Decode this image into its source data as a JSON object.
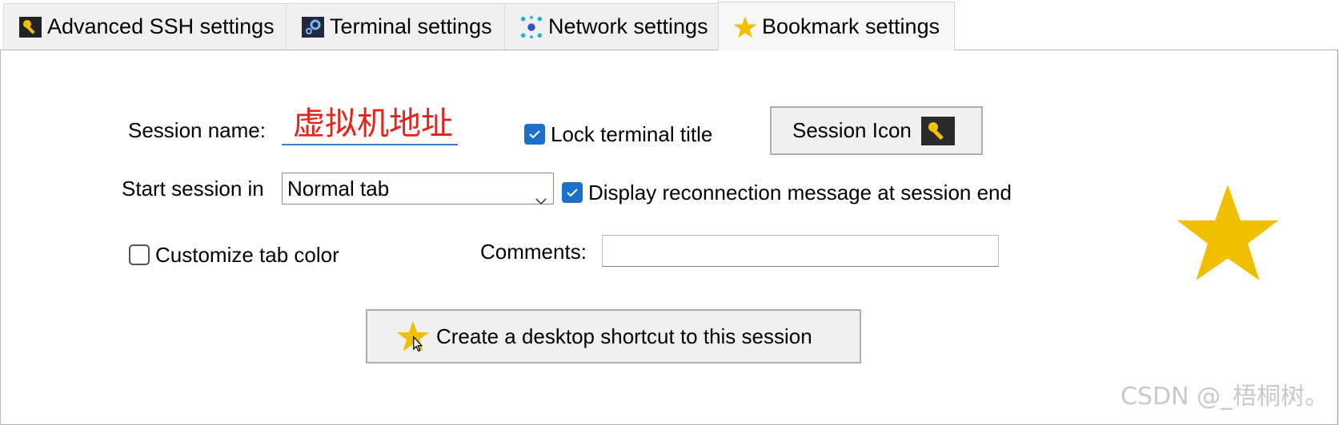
{
  "tabs": [
    {
      "label": "Advanced SSH settings",
      "icon": "key-icon",
      "active": false
    },
    {
      "label": "Terminal settings",
      "icon": "terminal-gear-icon",
      "active": false
    },
    {
      "label": "Network settings",
      "icon": "network-icon",
      "active": false
    },
    {
      "label": "Bookmark settings",
      "icon": "star-icon",
      "active": true
    }
  ],
  "form": {
    "session_name_label": "Session name:",
    "session_name_value": "虚拟机地址",
    "lock_title_label": "Lock terminal title",
    "lock_title_checked": true,
    "session_icon_label": "Session Icon",
    "start_session_label": "Start session in",
    "start_session_value": "Normal tab",
    "reconnect_label": "Display reconnection message at session end",
    "reconnect_checked": true,
    "customize_color_label": "Customize tab color",
    "customize_color_checked": false,
    "comments_label": "Comments:",
    "comments_value": "",
    "shortcut_button_label": "Create a desktop shortcut to this session"
  },
  "colors": {
    "accent": "#1d6fcc",
    "star": "#f0c000",
    "session_name_text": "#e8221b"
  },
  "watermark": "CSDN @_梧桐树。"
}
